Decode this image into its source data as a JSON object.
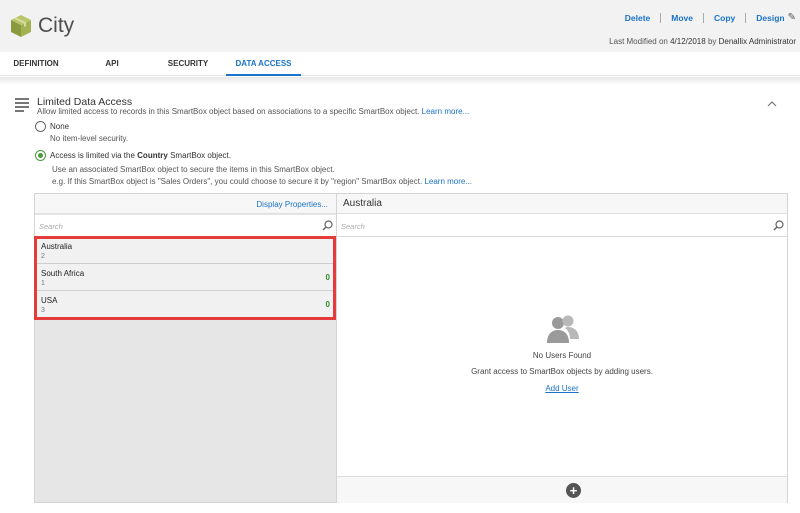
{
  "header": {
    "title": "City",
    "actions": [
      "Delete",
      "Move",
      "Copy",
      "Design"
    ],
    "modified_prefix": "Last Modified on",
    "modified_date": "4/12/2018",
    "modified_by_prefix": "by",
    "modified_by": "Denallix Administrator"
  },
  "tabs": [
    {
      "label": "DEFINITION",
      "active": false
    },
    {
      "label": "API",
      "active": false
    },
    {
      "label": "SECURITY",
      "active": false
    },
    {
      "label": "DATA ACCESS",
      "active": true
    }
  ],
  "section": {
    "title": "Limited Data Access",
    "description": "Allow limited access to records in this SmartBox object based on associations to a specific SmartBox object.",
    "learn_more": "Learn more..."
  },
  "options": {
    "none_label": "None",
    "none_desc": "No item-level security.",
    "limited_prefix": "Access is limited via the",
    "limited_object": "Country",
    "limited_suffix": "SmartBox object.",
    "limited_desc1": "Use an associated SmartBox object to secure the items in this SmartBox object.",
    "limited_desc2": "e.g. If this SmartBox object is \"Sales Orders\", you could choose to secure it by \"region\" SmartBox object.",
    "learn_more": "Learn more..."
  },
  "left_panel": {
    "display_properties": "Display Properties...",
    "search_placeholder": "Search",
    "items": [
      {
        "name": "Australia",
        "id": "2",
        "count": ""
      },
      {
        "name": "South Africa",
        "id": "1",
        "count": "0"
      },
      {
        "name": "USA",
        "id": "3",
        "count": "0"
      }
    ]
  },
  "right_panel": {
    "title": "Australia",
    "search_placeholder": "Search",
    "empty_title": "No Users Found",
    "empty_desc": "Grant access to SmartBox objects by adding users.",
    "add_user": "Add User"
  },
  "colors": {
    "accent": "#1a73c9",
    "highlight": "#e43b3b",
    "success": "#2e8b2e"
  }
}
